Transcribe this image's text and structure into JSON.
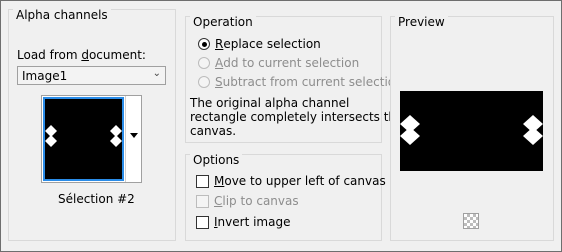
{
  "alpha_channels": {
    "title": "Alpha channels",
    "load_from_label_prefix": "Load from ",
    "load_from_label_underlined": "d",
    "load_from_label_suffix": "ocument:",
    "document_select_value": "Image1",
    "selection_name": "Sélection #2"
  },
  "operation": {
    "title": "Operation",
    "options": [
      {
        "u": "R",
        "rest": "eplace selection",
        "selected": true,
        "enabled": true
      },
      {
        "u": "A",
        "rest": "dd to current selection",
        "selected": false,
        "enabled": false
      },
      {
        "u": "S",
        "rest": "ubtract from current selection",
        "selected": false,
        "enabled": false
      }
    ],
    "note_line1": "The original alpha channel",
    "note_line2": "rectangle completely intersects the",
    "note_line3": "canvas."
  },
  "options": {
    "title": "Options",
    "items": [
      {
        "u": "M",
        "rest": "ove to upper left of canvas",
        "checked": false,
        "enabled": true
      },
      {
        "u": "C",
        "rest": "lip to canvas",
        "checked": false,
        "enabled": false
      },
      {
        "u": "I",
        "rest": "nvert image",
        "checked": false,
        "enabled": true
      }
    ]
  },
  "preview": {
    "title": "Preview"
  },
  "colors": {
    "accent": "#2a8ce8",
    "canvas": "#000000",
    "shape": "#ffffff"
  }
}
